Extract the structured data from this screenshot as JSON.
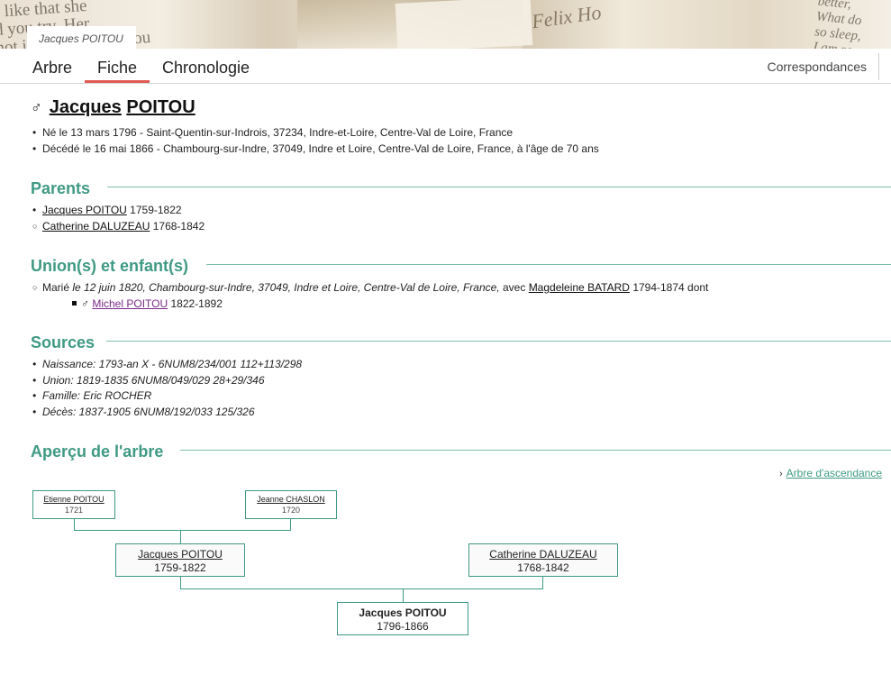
{
  "banner": {
    "person_tab": "Jacques POITOU",
    "decor_text_1": "s like that she\nd you try. Her\nnot in some ways. You\nmise, won't you\nbe tommy, but so\nwe're somethin",
    "decor_text_2": "Felix Ho",
    "decor_text_3": "better,\nWhat do\nso sleep,\nI am so"
  },
  "tabs": {
    "items": [
      "Arbre",
      "Fiche",
      "Chronologie"
    ],
    "active": "Fiche",
    "right": "Correspondances"
  },
  "person": {
    "sex_symbol": "♂",
    "first_name": "Jacques",
    "last_name": "POITOU",
    "birth": "Né le 13 mars 1796 - Saint-Quentin-sur-Indrois, 37234, Indre-et-Loire, Centre-Val de Loire, France",
    "death": "Décédé le 16 mai 1866 - Chambourg-sur-Indre, 37049, Indre et Loire, Centre-Val de Loire, France, à l'âge de 70 ans"
  },
  "parents": {
    "heading": "Parents",
    "father": {
      "name": "Jacques POITOU",
      "years": "1759-1822"
    },
    "mother": {
      "name": "Catherine DALUZEAU",
      "years": "1768-1842"
    }
  },
  "unions": {
    "heading": "Union(s) et enfant(s)",
    "prefix": "Marié",
    "detail": "le 12 juin 1820, Chambourg-sur-Indre, 37049, Indre et Loire, Centre-Val de Loire, France,",
    "avec": "avec",
    "spouse": "Magdeleine BATARD",
    "spouse_years": "1794-1874 dont",
    "child_symbol": "♂",
    "child": "Michel POITOU",
    "child_years": "1822-1892"
  },
  "sources": {
    "heading": "Sources",
    "items": [
      "Naissance: 1793-an X - 6NUM8/234/001 112+113/298",
      "Union: 1819-1835 6NUM8/049/029 28+29/346",
      "Famille: Eric ROCHER",
      "Décès: 1837-1905 6NUM8/192/033 125/326"
    ]
  },
  "tree": {
    "heading": "Aperçu de l'arbre",
    "link": "Arbre d'ascendance",
    "chevron": "›",
    "grandfather": {
      "name": "Etienne POITOU",
      "years": "1721"
    },
    "grandmother": {
      "name": "Jeanne CHASLON",
      "years": "1720"
    },
    "father": {
      "name": "Jacques POITOU",
      "years": "1759-1822"
    },
    "mother": {
      "name": "Catherine DALUZEAU",
      "years": "1768-1842"
    },
    "self": {
      "name": "Jacques POITOU",
      "years": "1796-1866"
    }
  },
  "colors": {
    "accent": "#3f9a84",
    "tab_underline": "#e05a55",
    "visited_link": "#7a2a8c"
  }
}
